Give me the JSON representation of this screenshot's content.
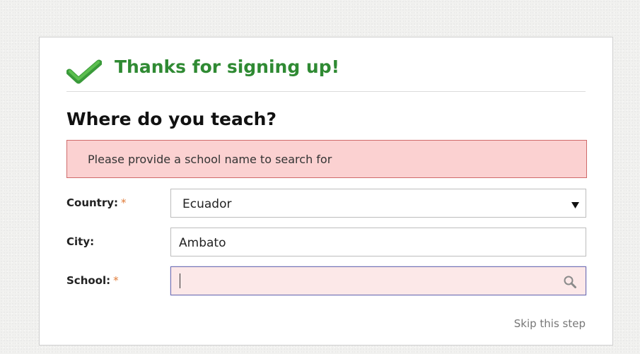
{
  "banner": {
    "title": "Thanks for signing up!",
    "icon": "check-icon",
    "color": "#2f8a33"
  },
  "heading": "Where do you teach?",
  "error": {
    "message": "Please provide a school name to search for",
    "background": "#fbd1d1",
    "border": "#cf6a6a"
  },
  "form": {
    "country": {
      "label": "Country:",
      "required_mark": "*",
      "selected": "Ecuador",
      "icon": "dropdown-arrow-icon"
    },
    "city": {
      "label": "City:",
      "value": "Ambato"
    },
    "school": {
      "label": "School:",
      "required_mark": "*",
      "value": "",
      "icon": "search-icon"
    }
  },
  "skip_link": "Skip this step",
  "colors": {
    "required": "#e07b39",
    "invalid_field_background": "#fce8e8"
  }
}
